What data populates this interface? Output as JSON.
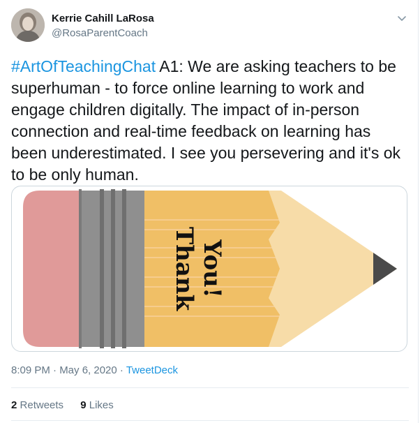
{
  "author": {
    "name": "Kerrie Cahill LaRosa",
    "handle": "@RosaParentCoach"
  },
  "tweet": {
    "hashtag": "#ArtOfTeachingChat",
    "body": " A1: We are asking teachers to be superhuman - to force online learning to work and engage children digitally. The impact of in-person connection and real-time feedback on learning has been underestimated. I see you persevering and it's ok to be only human."
  },
  "media": {
    "line1": "Thank",
    "line2": "You!"
  },
  "meta": {
    "time": "8:09 PM · May 6, 2020 · ",
    "source": "TweetDeck"
  },
  "stats": {
    "retweets_count": "2",
    "retweets_label": "Retweets",
    "likes_count": "9",
    "likes_label": "Likes"
  },
  "colors": {
    "link": "#1b95e0",
    "eraser": "#e09a99",
    "ferrule": "#8f8f8f",
    "pencil_body": "#f0bf66",
    "pencil_wood": "#f7dca8",
    "pencil_lead": "#4a4a4a"
  },
  "icons": {
    "menu": "chevron-down-icon"
  }
}
